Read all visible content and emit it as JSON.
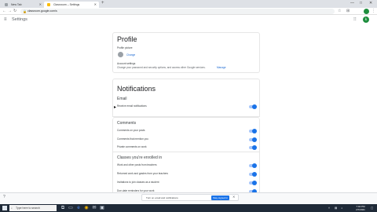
{
  "browser": {
    "tabs": [
      {
        "label": "New Tab"
      },
      {
        "label": "Classroom – Settings"
      }
    ],
    "address": "classroom.google.com/s",
    "window_controls": [
      "—",
      "□",
      "✕"
    ]
  },
  "app": {
    "title": "Settings",
    "avatar_initial": "k"
  },
  "profile": {
    "title": "Profile",
    "picture_label": "Profile picture",
    "change_link": "Change",
    "account_settings_label": "Account settings",
    "account_settings_desc": "Change your password and security options, and access other Google services.",
    "manage_link": "Manage"
  },
  "notifications": {
    "title": "Notifications",
    "email_heading": "Email",
    "email_item": "Receive email notifications",
    "comments_heading": "Comments",
    "comments_items": [
      "Comments on your posts",
      "Comments that mention you",
      "Private comments on work"
    ],
    "classes_heading": "Classes you're enrolled in",
    "classes_items": [
      "Work and other posts from teachers",
      "Returned work and grades from your teachers",
      "Invitations to join classes as a student",
      "Due-date reminders for your work"
    ]
  },
  "download_toast": {
    "text": "Turn on email and notifications",
    "button": "Stay signed in",
    "close": "✕"
  },
  "taskbar": {
    "search_placeholder": "Type here to search",
    "clock_time": "7:02 PM",
    "clock_date": "2/7/2021"
  },
  "colors": {
    "toggle_on": "#1a73e8",
    "taskbar": "#1f2a38",
    "avatar": "#1e8e3e"
  }
}
